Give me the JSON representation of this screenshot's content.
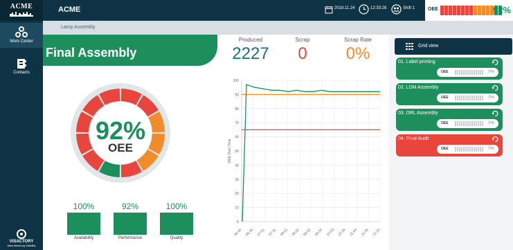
{
  "sidebar": {
    "logo": "ACME",
    "items": [
      {
        "label": "Work Center",
        "icon": "gears-icon"
      },
      {
        "label": "Contacts",
        "icon": "contacts-icon"
      }
    ],
    "brand": "VISACTORY",
    "brand_sub": "Manufacturing Visibility"
  },
  "header": {
    "title": "ACME",
    "date": "2018.11.24",
    "time": "12:33:28",
    "shift": "Shift 1",
    "oee_label": "OEE",
    "oee_value": "92%",
    "oee_bar_colors": [
      "#e8453c",
      "#e8453c",
      "#e8453c",
      "#e8453c",
      "#e8453c",
      "#e8453c",
      "#e8453c",
      "#e8453c",
      "#f28c28",
      "#f28c28",
      "#f28c28",
      "#f28c28",
      "#f28c28",
      "#1c8f5d",
      "#1c8f5d"
    ]
  },
  "breadcrumb": "Lamp Assembly",
  "page_title": "Final Assembly",
  "gauge": {
    "value": "92%",
    "label": "OEE",
    "segment_colors": [
      "#e8453c",
      "#e8453c",
      "#f28c28",
      "#f28c28",
      "#f28c28",
      "#e8453c",
      "#1c8f5d",
      "#e8453c",
      "#e8453c",
      "#e8453c",
      "#e8453c",
      "#e8453c"
    ]
  },
  "kpis": [
    {
      "value": "100%",
      "label": "Availability",
      "fill": 1.0
    },
    {
      "value": "92%",
      "label": "Performance",
      "fill": 0.92
    },
    {
      "value": "100%",
      "label": "Quality",
      "fill": 1.0
    }
  ],
  "stats": {
    "produced_label": "Produced",
    "produced_value": "2227",
    "scrap_label": "Scrap",
    "scrap_value": "0",
    "scrap_rate_label": "Scrap Rate",
    "scrap_rate_value": "0%"
  },
  "chart_data": {
    "type": "line",
    "ylabel": "OEE Over Time",
    "ylim": [
      0,
      100
    ],
    "yticks": [
      0,
      10,
      20,
      30,
      40,
      50,
      60,
      70,
      80,
      90,
      100
    ],
    "categories": [
      "06:00",
      "06:30",
      "07:01",
      "07:31",
      "08:01",
      "08:32",
      "09:02",
      "09:32",
      "10:03",
      "10:34",
      "11:04",
      "11:35",
      "12:20"
    ],
    "series": [
      {
        "color": "#1c8f5d",
        "values": [
          0,
          97,
          95,
          94,
          93,
          93,
          92,
          93,
          92,
          92,
          93,
          92,
          92,
          92,
          92,
          92,
          92,
          92
        ]
      }
    ],
    "reference_lines": [
      {
        "value": 90,
        "color": "#f28c28"
      },
      {
        "value": 65,
        "color": "#e8453c"
      }
    ],
    "grid": true
  },
  "grid_view": {
    "label": "Grid view",
    "stations": [
      {
        "name": "01. Label printing",
        "oee_label": "OEE",
        "value": "0%",
        "color": "#1c8f5d"
      },
      {
        "name": "02. LDM Assembly",
        "oee_label": "OEE",
        "value": "0%",
        "color": "#1c8f5d"
      },
      {
        "name": "03. DRL Assembly",
        "oee_label": "OEE",
        "value": "0%",
        "color": "#1c8f5d"
      },
      {
        "name": "04. Final Audit",
        "oee_label": "OEE",
        "value": "0%",
        "color": "#e8453c"
      }
    ]
  }
}
